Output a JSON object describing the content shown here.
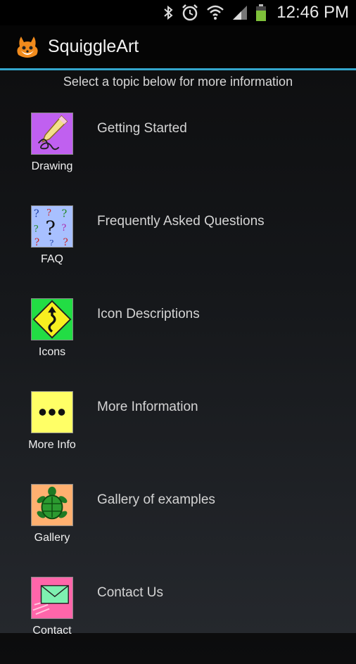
{
  "status_bar": {
    "time": "12:46 PM",
    "icons": [
      "bluetooth-icon",
      "alarm-icon",
      "wifi-icon",
      "signal-icon",
      "battery-icon"
    ]
  },
  "app": {
    "title": "SquiggleArt",
    "logo_icon": "fox-logo-icon",
    "accent_color": "#33a6cc"
  },
  "instructions": "Select a topic below for more information",
  "topics": [
    {
      "label": "Drawing",
      "title": "Getting Started",
      "icon": "pencil-squiggle-icon",
      "color": "#c060f0"
    },
    {
      "label": "FAQ",
      "title": "Frequently Asked Questions",
      "icon": "question-marks-icon",
      "color": "#a8c0ff"
    },
    {
      "label": "Icons",
      "title": "Icon Descriptions",
      "icon": "road-sign-icon",
      "color": "#22dd44"
    },
    {
      "label": "More Info",
      "title": "More Information",
      "icon": "dots-icon",
      "color": "#ffff66"
    },
    {
      "label": "Gallery",
      "title": "Gallery of examples",
      "icon": "turtle-icon",
      "color": "#ffb070"
    },
    {
      "label": "Contact",
      "title": "Contact Us",
      "icon": "envelope-icon",
      "color": "#ff66aa"
    }
  ]
}
